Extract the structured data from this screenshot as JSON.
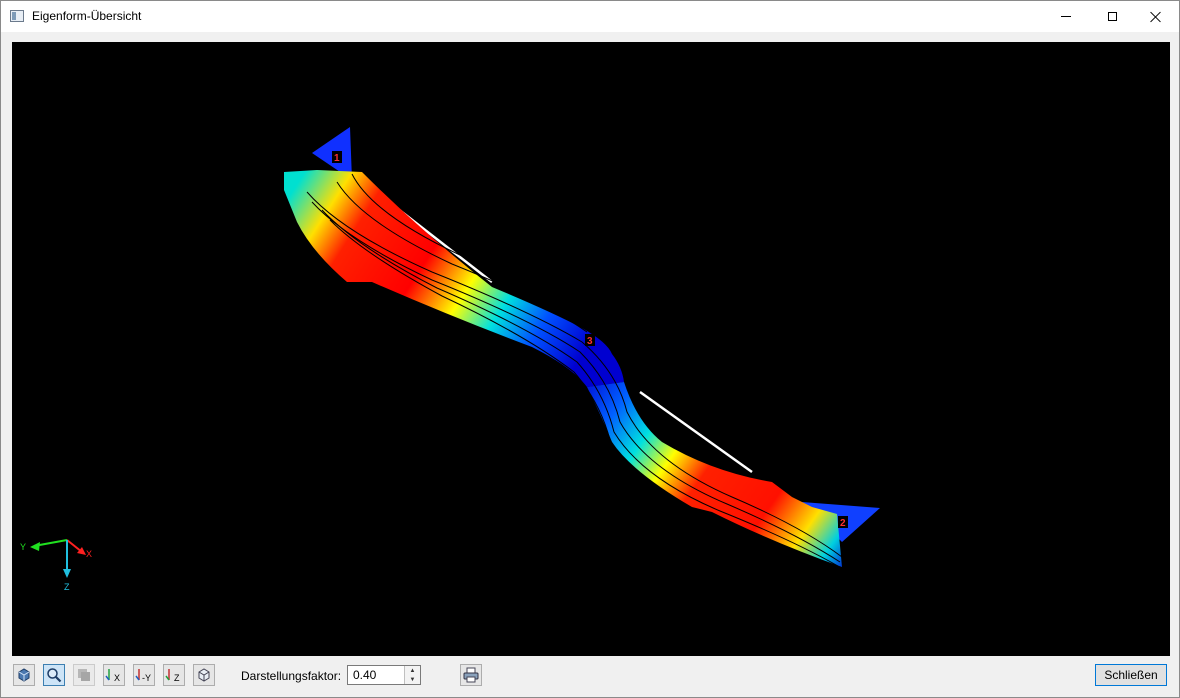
{
  "window": {
    "title": "Eigenform-Übersicht",
    "icon": "window-app-icon"
  },
  "viewport": {
    "background": "#000000",
    "node_labels": [
      "1",
      "3",
      "2"
    ],
    "axes": {
      "y": "Y",
      "x": "X",
      "z": "Z"
    },
    "colors": {
      "high": "#ff0000",
      "mid": "#ffff00",
      "low": "#0000ff"
    }
  },
  "toolbar": {
    "buttons": [
      {
        "name": "print-graphic-button",
        "icon": "box-view-icon"
      },
      {
        "name": "zoom-button",
        "icon": "magnifier-icon",
        "active": true
      },
      {
        "name": "render-mode-button",
        "icon": "solid-render-icon",
        "disabled": true
      },
      {
        "name": "view-x-button",
        "icon": "view-x-icon",
        "label": "X"
      },
      {
        "name": "view-minus-y-button",
        "icon": "view-minus-y-icon",
        "label": "-Y"
      },
      {
        "name": "view-z-button",
        "icon": "view-z-icon",
        "label": "Z"
      },
      {
        "name": "isometric-view-button",
        "icon": "isometric-icon"
      }
    ],
    "factor_label": "Darstellungsfaktor:",
    "factor_value": "0.40",
    "print_icon": "printer-icon",
    "close_label": "Schließen"
  }
}
